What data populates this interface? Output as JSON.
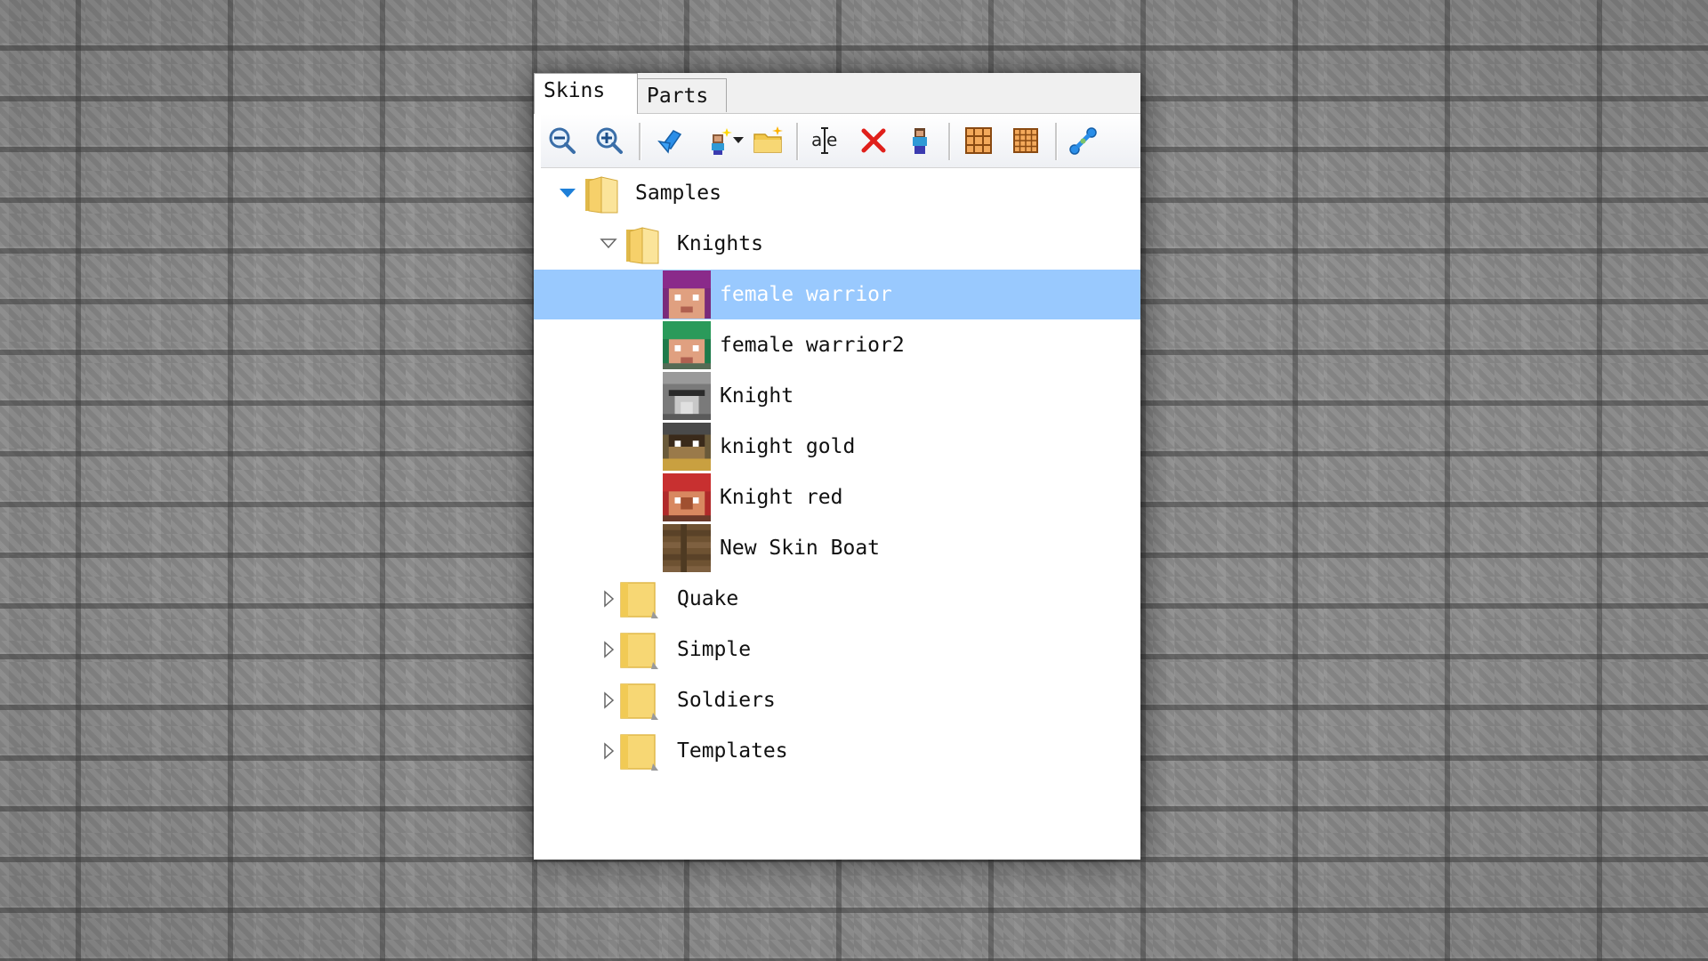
{
  "tabs": [
    {
      "label": "Skins"
    },
    {
      "label": "Parts"
    }
  ],
  "toolbar": {
    "icons": [
      "zoom-out-icon",
      "zoom-in-icon",
      "import-icon",
      "new-skin-icon",
      "new-folder-icon",
      "rename-icon",
      "delete-icon",
      "clone-icon",
      "grid-icon",
      "small-grid-icon",
      "links-icon"
    ]
  },
  "tree": {
    "root": {
      "label": "Samples",
      "expanded": true
    },
    "knights": {
      "label": "Knights",
      "expanded": true
    },
    "skins": [
      {
        "label": "female warrior",
        "selected": true
      },
      {
        "label": "female warrior2",
        "selected": false
      },
      {
        "label": "Knight",
        "selected": false
      },
      {
        "label": "knight gold",
        "selected": false
      },
      {
        "label": "Knight red",
        "selected": false
      },
      {
        "label": "New Skin Boat",
        "selected": false
      }
    ],
    "folders": [
      {
        "label": "Quake",
        "expanded": false
      },
      {
        "label": "Simple",
        "expanded": false
      },
      {
        "label": "Soldiers",
        "expanded": false
      },
      {
        "label": "Templates",
        "expanded": false
      }
    ]
  },
  "colors": {
    "selection": "#99c9fe",
    "folder": "#f7d774",
    "expander_open": "#1e7fd8"
  }
}
